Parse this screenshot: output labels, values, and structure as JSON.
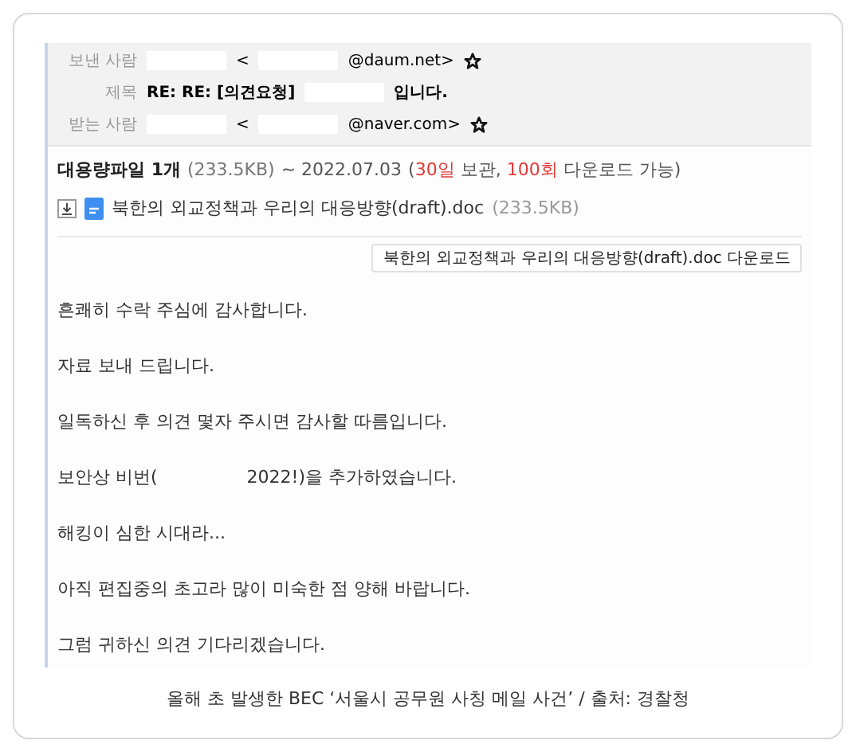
{
  "header": [
    {
      "label": "보낸 사람",
      "bold": false,
      "star": true,
      "segments": [
        {
          "kind": "redacted"
        },
        {
          "kind": "text",
          "text": "<"
        },
        {
          "kind": "redacted"
        },
        {
          "kind": "text",
          "text": "@daum.net>"
        }
      ]
    },
    {
      "label": "제목",
      "bold": true,
      "star": false,
      "segments": [
        {
          "kind": "text",
          "text": "RE: RE: [의견요청]"
        },
        {
          "kind": "redacted"
        },
        {
          "kind": "text",
          "text": "입니다."
        }
      ]
    },
    {
      "label": "받는 사람",
      "bold": false,
      "star": true,
      "segments": [
        {
          "kind": "redacted"
        },
        {
          "kind": "text",
          "text": "<"
        },
        {
          "kind": "redacted"
        },
        {
          "kind": "text",
          "text": "@naver.com>"
        }
      ]
    }
  ],
  "file_info": {
    "title": "대용량파일 1개",
    "size": "(233.5KB)",
    "expiry": "~ 2022.07.03",
    "open": "(",
    "days": "30일",
    "keep": "보관,",
    "count": "100회",
    "rest": "다운로드 가능)"
  },
  "attachment": {
    "name": "북한의 외교정책과 우리의 대응방향(draft).doc",
    "size": "(233.5KB)"
  },
  "download_button": "북한의 외교정책과 우리의 대응방향(draft).doc 다운로드",
  "body": [
    [
      {
        "kind": "text",
        "text": "흔쾌히 수락 주심에 감사합니다."
      }
    ],
    [
      {
        "kind": "text",
        "text": "자료 보내 드립니다."
      }
    ],
    [
      {
        "kind": "text",
        "text": "일독하신 후 의견 몇자 주시면 감사할 따름입니다."
      }
    ],
    [
      {
        "kind": "text",
        "text": "보안상 비번("
      },
      {
        "kind": "redacted"
      },
      {
        "kind": "text",
        "text": "2022!)을 추가하였습니다."
      }
    ],
    [
      {
        "kind": "text",
        "text": "해킹이 심한 시대라..."
      }
    ],
    [
      {
        "kind": "text",
        "text": "아직 편집중의 초고라 많이 미숙한 점 양해 바랍니다."
      }
    ],
    [
      {
        "kind": "text",
        "text": "그럼 귀하신 의견 기다리겠습니다."
      }
    ]
  ],
  "caption": "올해 초 발생한 BEC ‘서울시 공무원 사칭 메일 사건’ / 출처: 경찰청"
}
